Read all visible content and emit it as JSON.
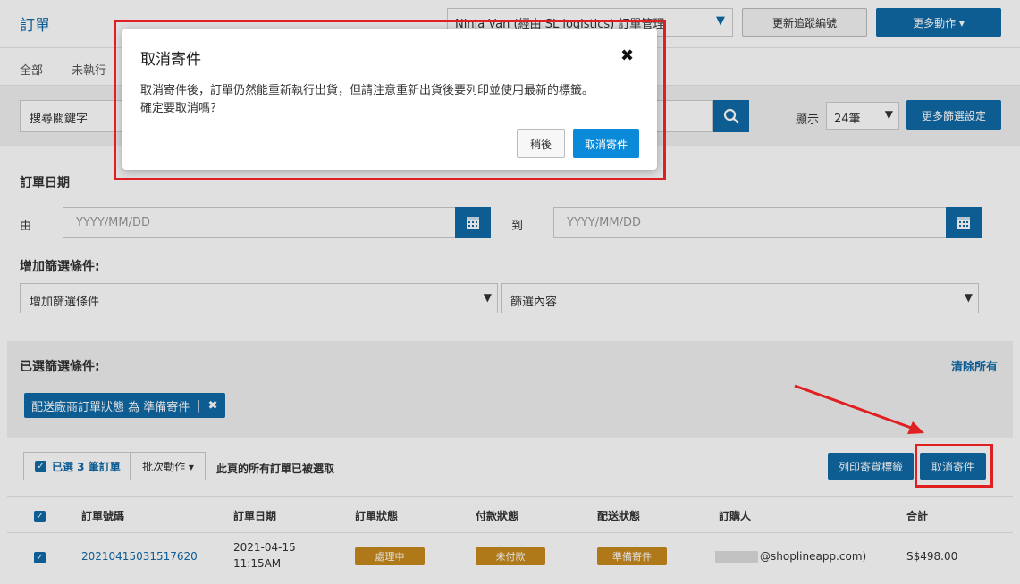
{
  "header": {
    "title": "訂單",
    "logistics_select": "Ninja Van (經由 SL logistics) 訂單管理",
    "update_tracking_label": "更新追蹤編號",
    "more_actions_label": "更多動作 ▾"
  },
  "tabs": [
    "全部",
    "未執行"
  ],
  "search": {
    "placeholder": "搜尋關鍵字",
    "show_label": "顯示",
    "per_page": "24筆",
    "more_filters_label": "更多篩選設定"
  },
  "date_filter": {
    "title": "訂單日期",
    "from_label": "由",
    "from_placeholder": "YYYY/MM/DD",
    "to_label": "到",
    "to_placeholder": "YYYY/MM/DD"
  },
  "add_filter": {
    "title": "增加篩選條件:",
    "condition_select": "增加篩選條件",
    "content_select": "篩選內容"
  },
  "selected_filters": {
    "title": "已選篩選條件:",
    "clear_all": "清除所有",
    "chip_label": "配送廠商訂單狀態 為 準備寄件",
    "chip_separator": "|",
    "chip_remove": "✖"
  },
  "bulk": {
    "selected_count": "已選 3 筆訂單",
    "batch_actions": "批次動作 ▾",
    "note": "此頁的所有訂單已被選取",
    "print_label": "列印寄貨標籤",
    "cancel_shipment": "取消寄件"
  },
  "table": {
    "headers": [
      "訂單號碼",
      "訂單日期",
      "訂單狀態",
      "付款狀態",
      "配送狀態",
      "訂購人",
      "合計"
    ],
    "rows": [
      {
        "order_no": "20210415031517620",
        "date": "2021-04-15",
        "time": "11:15AM",
        "order_status": "處理中",
        "payment_status": "未付款",
        "shipping_status": "準備寄件",
        "customer": "@shoplineapp.com)",
        "total": "S$498.00"
      }
    ]
  },
  "modal": {
    "title": "取消寄件",
    "close": "✖",
    "line1": "取消寄件後，訂單仍然能重新執行出貨，但請注意重新出貨後要列印並使用最新的標籤。",
    "line2": "確定要取消嗎？",
    "later_label": "稍後",
    "confirm_label": "取消寄件"
  },
  "colors": {
    "primary": "#0f6aa8",
    "confirm": "#0a8ad8",
    "status_tag": "#c88a1e",
    "annotation": "#e02020"
  }
}
